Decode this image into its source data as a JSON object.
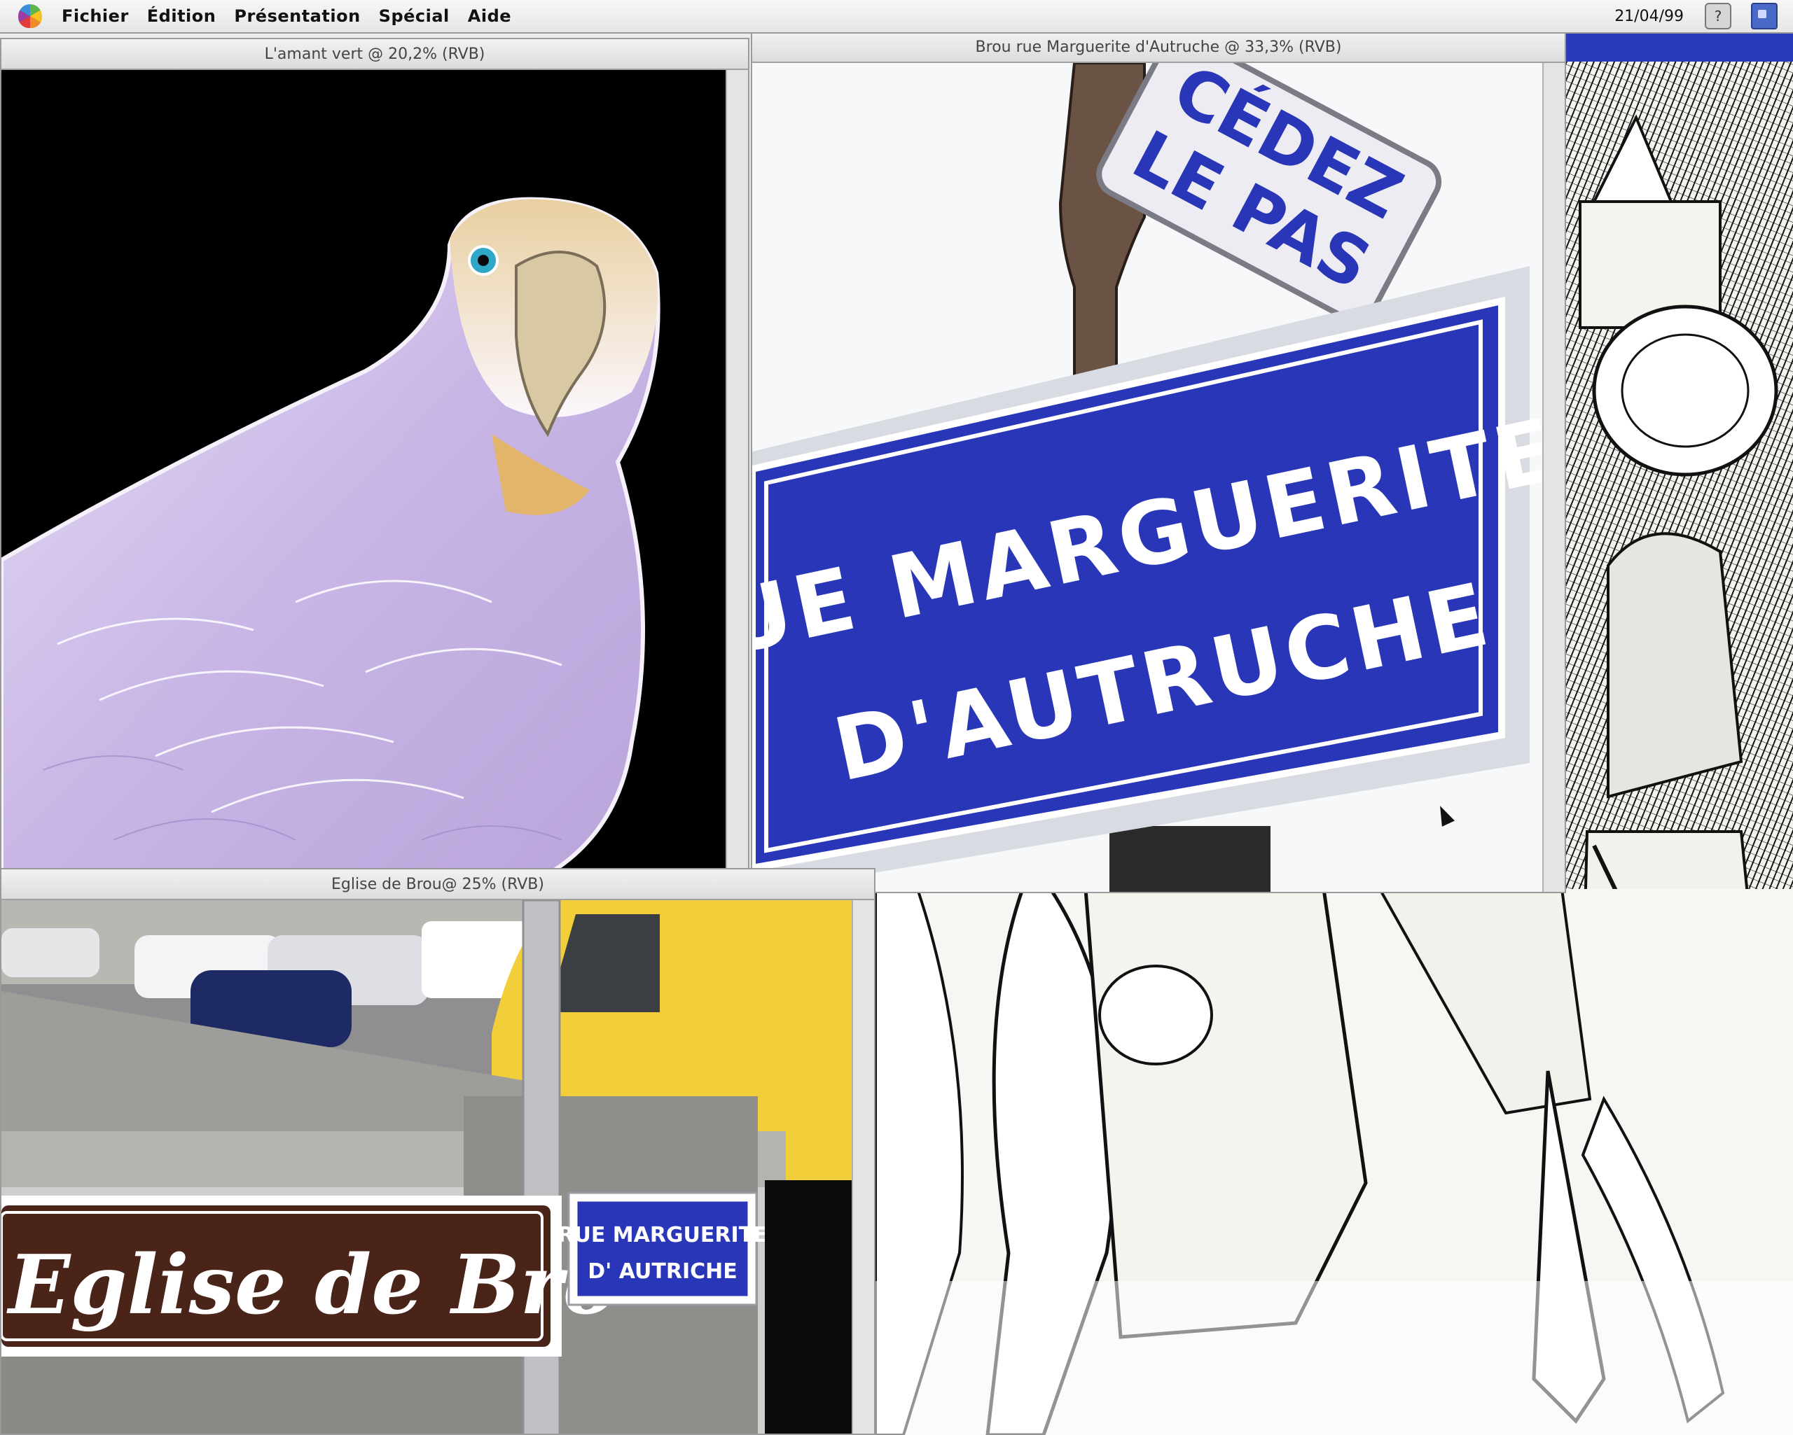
{
  "menubar": {
    "items": [
      "Fichier",
      "Édition",
      "Présentation",
      "Spécial",
      "Aide"
    ],
    "clock": "21/04/99"
  },
  "windows": {
    "parrot": {
      "title": "L'amant vert @ 20,2% (RVB)"
    },
    "sign": {
      "title": "Brou rue Marguerite d'Autruche @ 33,3% (RVB)",
      "small_sign_line1": "CÉDEZ",
      "small_sign_line2": "LE PAS",
      "main_sign_line1": "RUE MARGUERITE",
      "main_sign_line2": "D'AUTRUCHE"
    },
    "eglise": {
      "title": "Eglise de Brou@ 25% (RVB)",
      "brown_sign": "Eglise de Bro",
      "small_sign_line1": "RUE MARGUERITE",
      "small_sign_line2": "D' AUTRICHE"
    }
  },
  "colors": {
    "sign_blue": "#2a36b8",
    "brown_sign": "#4a2418",
    "van_yellow": "#f2cf3a",
    "menubar_blue": "#2b3ab8"
  },
  "icons": [
    "apple-menu-icon",
    "help-icon",
    "finder-icon",
    "arrow-cursor-icon"
  ]
}
